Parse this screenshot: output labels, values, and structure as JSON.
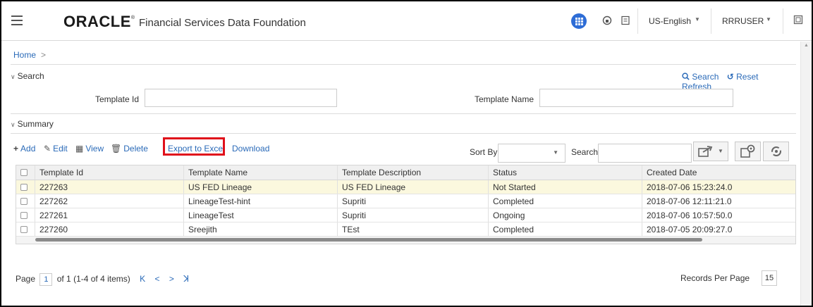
{
  "header": {
    "brand": "ORACLE",
    "brand_mark": "®",
    "product": "Financial Services Data Foundation",
    "language": "US-English",
    "user": "RRRUSER",
    "accent_color": "#2e6dd6"
  },
  "breadcrumb": {
    "home": "Home",
    "separator": ">"
  },
  "search": {
    "title": "Search",
    "actions": {
      "search": "Search",
      "reset": "Reset",
      "refresh": "Refresh"
    },
    "fields": {
      "template_id_label": "Template Id",
      "template_id_value": "",
      "template_name_label": "Template Name",
      "template_name_value": ""
    }
  },
  "summary": {
    "title": "Summary",
    "toolbar": {
      "add": "Add",
      "edit": "Edit",
      "view": "View",
      "delete": "Delete",
      "export": "Export to Excel",
      "download": "Download"
    },
    "sort_by_label": "Sort By",
    "sort_by_value": "",
    "search_label": "Search",
    "search_value": ""
  },
  "table": {
    "columns": [
      "Template Id",
      "Template Name",
      "Template Description",
      "Status",
      "Created Date"
    ],
    "rows": [
      [
        "227263",
        "US FED Lineage",
        "US FED Lineage",
        "Not Started",
        "2018-07-06 15:23:24.0"
      ],
      [
        "227262",
        "LineageTest-hint",
        "Supriti",
        "Completed",
        "2018-07-06 12:11:21.0"
      ],
      [
        "227261",
        "LineageTest",
        "Supriti",
        "Ongoing",
        "2018-07-06 10:57:50.0"
      ],
      [
        "227260",
        "Sreejith",
        "TEst",
        "Completed",
        "2018-07-05 20:09:27.0"
      ]
    ]
  },
  "pager": {
    "page_label": "Page",
    "page": "1",
    "of_text": "of 1 (1-4 of 4 items)",
    "nav_first": "K",
    "nav_prev": "<",
    "nav_next": ">",
    "nav_last": "ꓘ",
    "records_per_page_label": "Records Per Page",
    "records_per_page": "15"
  },
  "icons": {
    "menu": "hamburger-icon",
    "apps": "apps-grid-icon",
    "help": "help-icon",
    "book": "book-icon",
    "add": "plus-icon",
    "edit": "edit-icon",
    "view": "view-icon",
    "delete": "trash-icon",
    "export": "export-icon",
    "settings": "settings-icon",
    "reload": "reload-icon"
  },
  "colors": {
    "highlight": "#e0101b",
    "link": "#2a6ab8",
    "selected_row": "#fbf8de"
  }
}
